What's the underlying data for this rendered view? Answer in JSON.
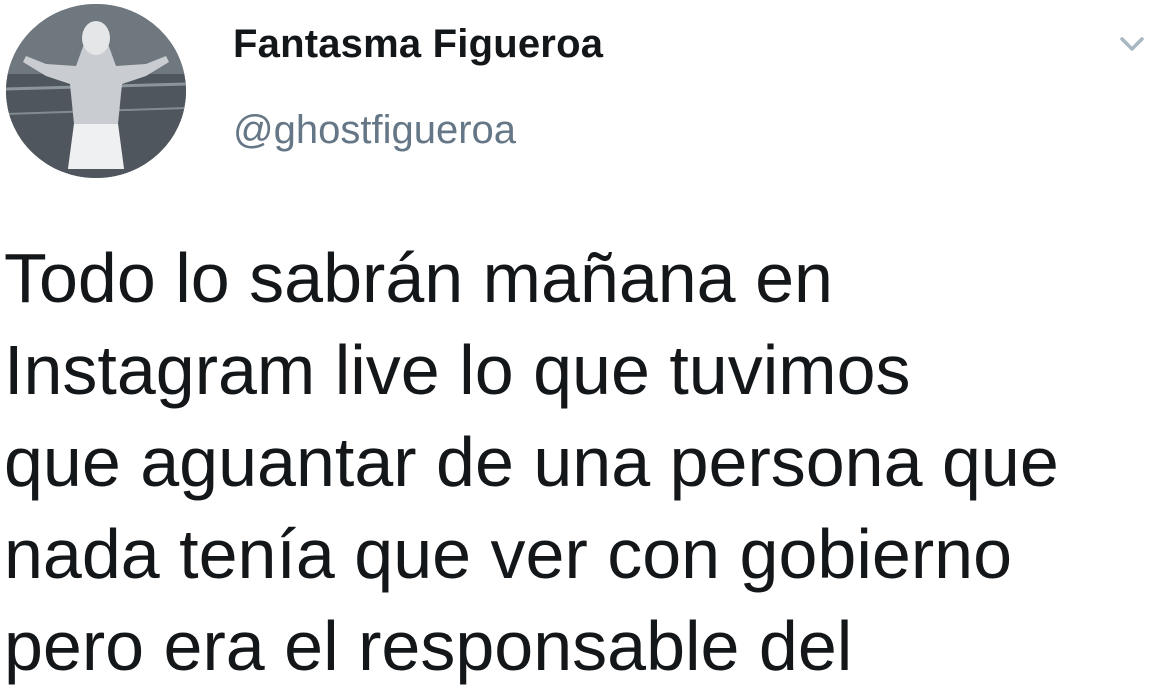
{
  "tweet": {
    "author": {
      "display_name": "Fantasma Figueroa",
      "handle": "@ghostfigueroa",
      "avatar_icon": "profile-photo"
    },
    "menu_icon": "chevron-down-icon",
    "text_lines": [
      "Todo lo sabrán mañana en",
      "Instagram live lo que tuvimos",
      "que aguantar de una persona que",
      "nada tenía que ver con gobierno",
      "pero era el responsable del"
    ]
  },
  "colors": {
    "text_primary": "#14171a",
    "text_secondary": "#657786",
    "caret": "#aab8c2",
    "background": "#ffffff"
  }
}
